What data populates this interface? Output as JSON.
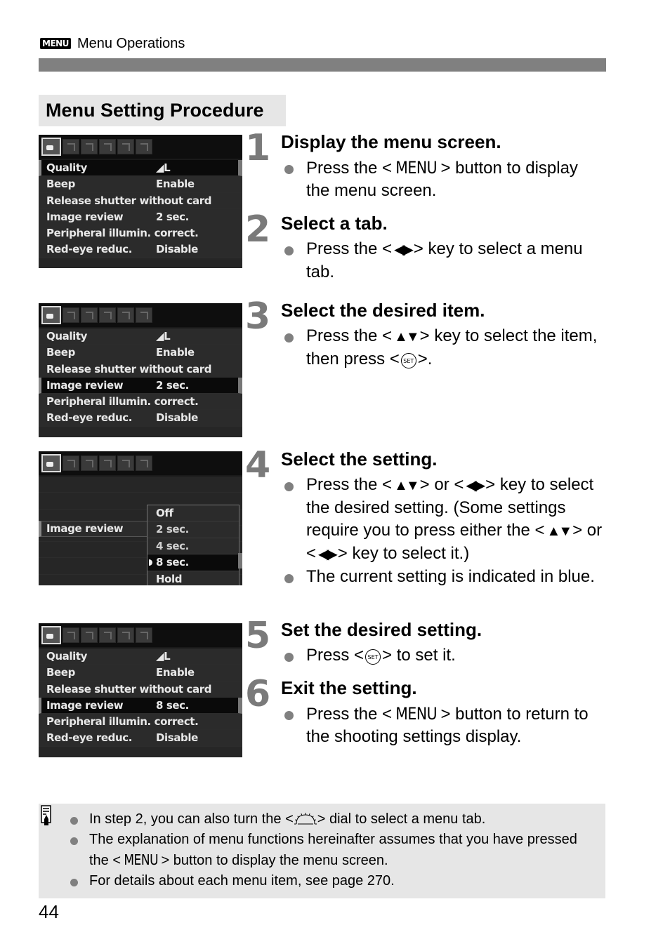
{
  "header": {
    "menu_badge": "MENU",
    "section": "Menu Operations"
  },
  "section_title": "Menu Setting Procedure",
  "screens": [
    {
      "id": "screen-1",
      "rows": [
        {
          "label": "Quality",
          "value": "◢L",
          "selected": true
        },
        {
          "label": "Beep",
          "value": "Enable"
        },
        {
          "label": "Release shutter without card",
          "value": ""
        },
        {
          "label": "Image review",
          "value": "2 sec."
        },
        {
          "label": "Peripheral illumin. correct.",
          "value": ""
        },
        {
          "label": "Red-eye reduc.",
          "value": "Disable"
        }
      ]
    },
    {
      "id": "screen-3",
      "rows": [
        {
          "label": "Quality",
          "value": "◢L"
        },
        {
          "label": "Beep",
          "value": "Enable"
        },
        {
          "label": "Release shutter without card",
          "value": ""
        },
        {
          "label": "Image review",
          "value": "2 sec.",
          "selected": true
        },
        {
          "label": "Peripheral illumin. correct.",
          "value": ""
        },
        {
          "label": "Red-eye reduc.",
          "value": "Disable"
        }
      ]
    },
    {
      "id": "screen-4",
      "item_label": "Image review",
      "options": [
        "Off",
        "2 sec.",
        "4 sec.",
        "8 sec.",
        "Hold"
      ],
      "current_option": "8 sec."
    },
    {
      "id": "screen-5",
      "rows": [
        {
          "label": "Quality",
          "value": "◢L"
        },
        {
          "label": "Beep",
          "value": "Enable"
        },
        {
          "label": "Release shutter without card",
          "value": ""
        },
        {
          "label": "Image review",
          "value": "8 sec.",
          "selected": true
        },
        {
          "label": "Peripheral illumin. correct.",
          "value": ""
        },
        {
          "label": "Red-eye reduc.",
          "value": "Disable"
        }
      ]
    }
  ],
  "steps": [
    {
      "num": "1",
      "title": "Display the menu screen.",
      "bullets": [
        [
          "Press the <",
          "MENU",
          "> button to display the menu screen."
        ]
      ]
    },
    {
      "num": "2",
      "title": "Select a tab.",
      "bullets": [
        [
          "Press the <",
          "◀▶",
          "> key to select a menu tab."
        ]
      ]
    },
    {
      "num": "3",
      "title": "Select the desired item.",
      "bullets": [
        [
          "Press the <",
          "▲▼",
          "> key to select the item, then press <",
          "SET",
          ">."
        ]
      ]
    },
    {
      "num": "4",
      "title": "Select the setting.",
      "bullets": [
        [
          "Press the <",
          "▲▼",
          "> or <",
          "◀▶",
          "> key to select the desired setting. (Some settings require you to press either the <",
          "▲▼",
          "> or <",
          "◀▶",
          "> key to select it.)"
        ],
        [
          "The current setting is indicated in blue."
        ]
      ]
    },
    {
      "num": "5",
      "title": "Set the desired setting.",
      "bullets": [
        [
          "Press <",
          "SET",
          "> to set it."
        ]
      ]
    },
    {
      "num": "6",
      "title": "Exit the setting.",
      "bullets": [
        [
          "Press the <",
          "MENU",
          "> button to return to the shooting settings display."
        ]
      ]
    }
  ],
  "note": {
    "icon": "note-pencil-icon",
    "items": [
      {
        "before": "In step 2, you can also turn the <",
        "icon": "main-dial-icon",
        "after": "> dial to select a menu tab."
      },
      {
        "before": "The explanation of menu functions hereinafter assumes that you have pressed the <",
        "menu": "MENU",
        "after": "> button to display the menu screen."
      },
      {
        "before": "For details about each menu item, see page 270."
      }
    ]
  },
  "page_number": "44"
}
